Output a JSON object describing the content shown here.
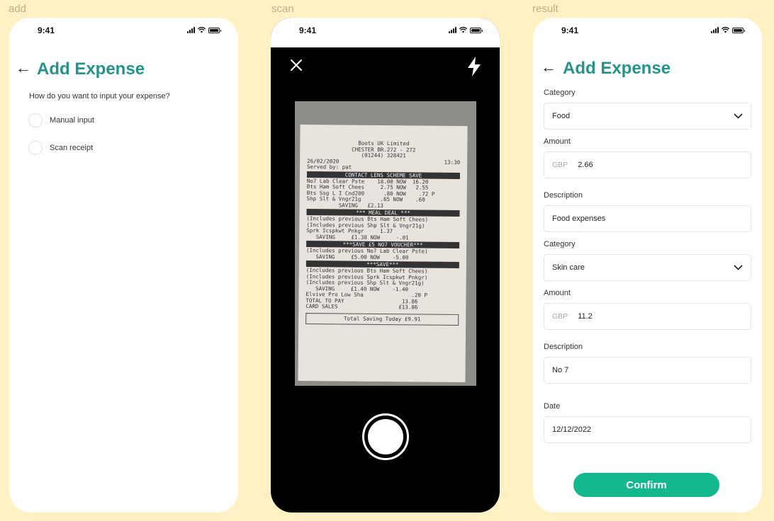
{
  "labels": {
    "add": "add",
    "scan": "scan",
    "result": "result"
  },
  "status": {
    "time": "9:41"
  },
  "add_screen": {
    "title": "Add Expense",
    "question": "How do you want to input your expense?",
    "options": [
      "Manual input",
      "Scan receipt"
    ]
  },
  "scan_screen": {
    "receipt": {
      "header": [
        "Boots UK Limited",
        "CHESTER BR.272 - 272",
        "(01244) 328421"
      ],
      "date": "26/02/2020",
      "time": "13:30",
      "served": "Served by: pat",
      "bar1": "CONTACT LENS SCHEME SAVE",
      "items1": [
        "No7 Lab Clear Pste    18.00 NOW  16.20",
        "Bts Ham Soft Chees     2.75 NOW   2.55",
        "Bts Ssg L I Cnd200      .80 NOW    .72 P",
        "Shp Slt & Vngr21g      .65 NOW    .60"
      ],
      "saving1": "SAVING   £2.13",
      "bar2": "*** MEAL DEAL ***",
      "items2": [
        "(Includes previous Bts Ham Soft Chees)",
        "(Includes previous Shp Slt & Vngr21g)",
        "Sprk Icspkwt Pnkgr     1.37",
        "   SAVING     £1.38 NOW     -.01"
      ],
      "bar3": "***SAVE £5 NO7 VOUCHER***",
      "items3": [
        "(Includes previous No7 Lab Clear Pste)",
        "   SAVING     £5.00 NOW    -5.00"
      ],
      "bar4": "***SAVE***",
      "items4": [
        "(Includes previous Bts Ham Soft Chees)",
        "(Includes previous Sprk Icspkwt Pnkgr)",
        "(Includes previous Shp Slt & Vngr21g)",
        "   SAVING     £1.40 NOW    -1.40",
        "",
        "Elvive Pro Low Sha               .20 P",
        "",
        "TOTAL TO PAY                  13.86",
        "CARD SALES                   £13.86"
      ],
      "total_saving": "Total Saving Today £9.91"
    }
  },
  "result_screen": {
    "title": "Add Expense",
    "fields": {
      "category1_label": "Category",
      "category1_value": "Food",
      "amount1_label": "Amount",
      "amount1_currency": "GBP",
      "amount1_value": "2.66",
      "description1_label": "Description",
      "description1_value": "Food expenses",
      "category2_label": "Category",
      "category2_value": "Skin care",
      "amount2_label": "Amount",
      "amount2_currency": "GBP",
      "amount2_value": "11.2",
      "description2_label": "Description",
      "description2_value": "No 7",
      "date_label": "Date",
      "date_value": "12/12/2022"
    },
    "confirm_label": "Confirm"
  }
}
